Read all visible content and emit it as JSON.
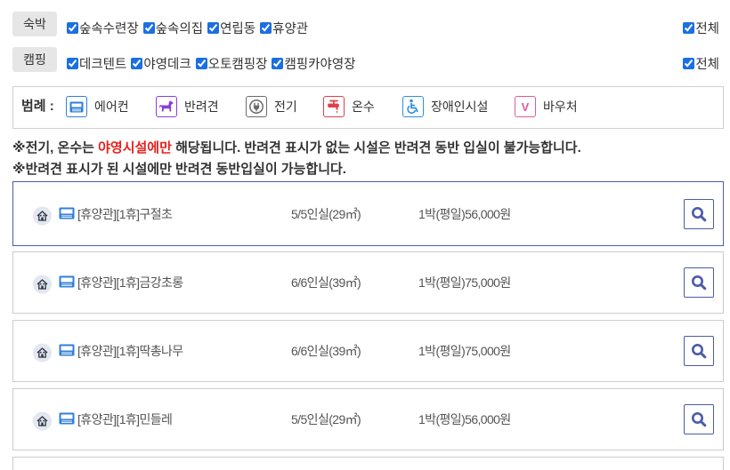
{
  "filters": {
    "lodging": {
      "label": "숙박",
      "options": [
        {
          "label": "숲속수련장",
          "checked": true
        },
        {
          "label": "숲속의집",
          "checked": true
        },
        {
          "label": "연립동",
          "checked": true
        },
        {
          "label": "휴양관",
          "checked": true
        }
      ],
      "all": {
        "label": "전체",
        "checked": true
      }
    },
    "camping": {
      "label": "캠핑",
      "options": [
        {
          "label": "데크텐트",
          "checked": true
        },
        {
          "label": "야영데크",
          "checked": true
        },
        {
          "label": "오토캠핑장",
          "checked": true
        },
        {
          "label": "캠핑카야영장",
          "checked": true
        }
      ],
      "all": {
        "label": "전체",
        "checked": true
      }
    }
  },
  "legend": {
    "title": "범례 :",
    "items": [
      {
        "label": "에어컨",
        "icon": "air-conditioner-icon",
        "color": "#2f7fd8"
      },
      {
        "label": "반려견",
        "icon": "dog-icon",
        "color": "#8b3fd9"
      },
      {
        "label": "전기",
        "icon": "plug-icon",
        "color": "#6b6b6b"
      },
      {
        "label": "온수",
        "icon": "hot-water-icon",
        "color": "#e0404a"
      },
      {
        "label": "장애인시설",
        "icon": "wheelchair-icon",
        "color": "#2f8fe0"
      },
      {
        "label": "바우처",
        "icon": "voucher-icon",
        "color": "#e05a9a",
        "glyph": "V"
      }
    ]
  },
  "notices": {
    "line1": {
      "prefix": "※전기, 온수는 ",
      "highlight": "야영시설에만",
      "suffix": " 해당됩니다. 반려견 표시가 없는 시설은 반려견 동반 입실이 불가능합니다.",
      "highlight_color": "#e8201c"
    },
    "line2": "※반려견 표시가 된 시설에만 반려견 동반입실이 가능합니다."
  },
  "rooms": [
    {
      "name": "[휴양관][1휴]구절초",
      "capacity": "5/5인실(29㎡)",
      "price": "1박(평일)56,000원",
      "amenities": [
        "house-icon",
        "air-conditioner-icon"
      ],
      "selected": true
    },
    {
      "name": "[휴양관][1휴]금강초롱",
      "capacity": "6/6인실(39㎡)",
      "price": "1박(평일)75,000원",
      "amenities": [
        "house-icon",
        "air-conditioner-icon"
      ],
      "selected": false
    },
    {
      "name": "[휴양관][1휴]딱총나무",
      "capacity": "6/6인실(39㎡)",
      "price": "1박(평일)75,000원",
      "amenities": [
        "house-icon",
        "air-conditioner-icon"
      ],
      "selected": false
    },
    {
      "name": "[휴양관][1휴]민들레",
      "capacity": "5/5인실(29㎡)",
      "price": "1박(평일)56,000원",
      "amenities": [
        "house-icon",
        "air-conditioner-icon"
      ],
      "selected": false
    }
  ],
  "colors": {
    "accent": "#4a5ca8",
    "checkbox": "#1b6fe3",
    "border": "#cccccc"
  }
}
